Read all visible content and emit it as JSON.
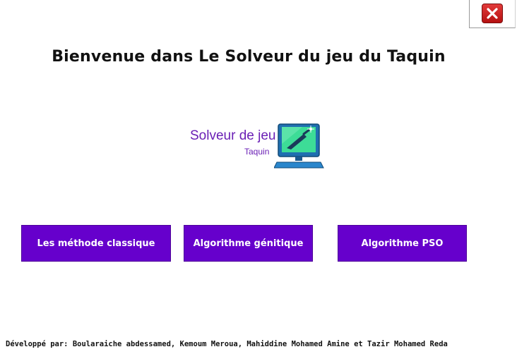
{
  "window": {
    "close_icon": "close-icon"
  },
  "header": {
    "title": "Bienvenue dans Le Solveur du jeu du Taquin"
  },
  "logo": {
    "title": "Solveur de jeu",
    "subtitle": "Taquin",
    "icon": "computer-icon",
    "colors": {
      "text": "#6a1fb5",
      "screen": "#3ddc97"
    }
  },
  "menu": {
    "classic_label": "Les méthode classique",
    "genetic_label": "Algorithme génitique",
    "pso_label": "Algorithme PSO",
    "button_color": "#6600cc"
  },
  "footer": {
    "credits": "Développé par: Boularaiche abdessamed, Kemoum Meroua, Mahiddine Mohamed Amine et Tazir Mohamed Reda"
  }
}
